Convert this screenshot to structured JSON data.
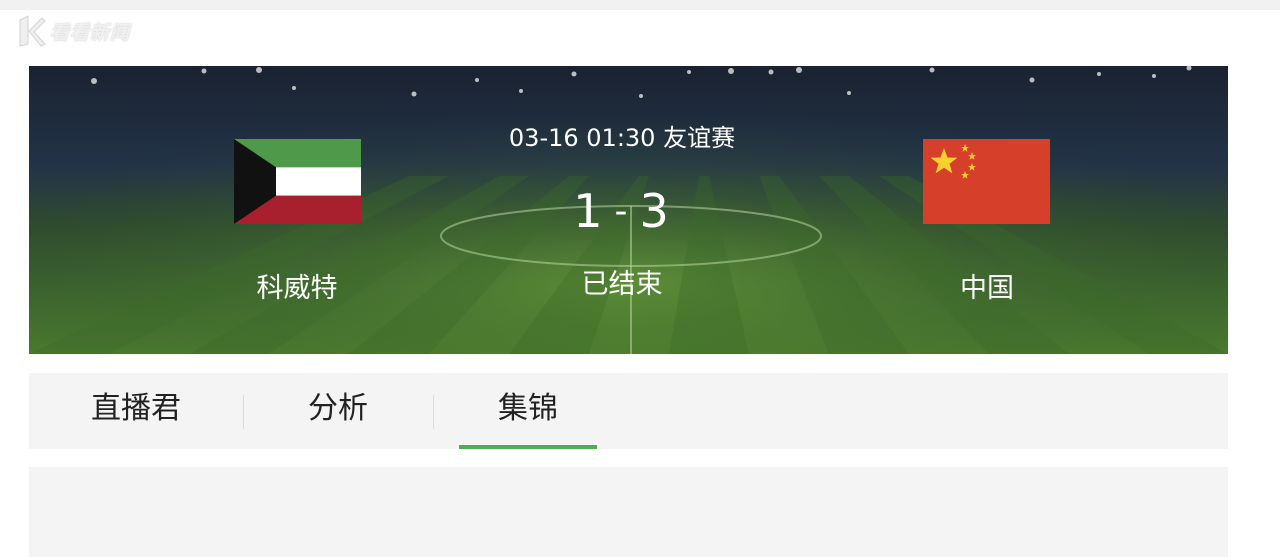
{
  "watermark": {
    "text": "看看新闻"
  },
  "match": {
    "datetime": "03-16 01:30",
    "competition": "友谊赛",
    "home_team": "科威特",
    "away_team": "中国",
    "home_score": "1",
    "away_score": "3",
    "score_separator": "-",
    "status": "已结束"
  },
  "tabs": [
    {
      "label": "直播君",
      "active": false
    },
    {
      "label": "分析",
      "active": false
    },
    {
      "label": "集锦",
      "active": true
    }
  ],
  "colors": {
    "active_tab_underline": "#4caf50",
    "kuwait_green": "#4e9a4a",
    "kuwait_red": "#a8202e",
    "china_red": "#d6402a",
    "china_star": "#f6d02c"
  }
}
